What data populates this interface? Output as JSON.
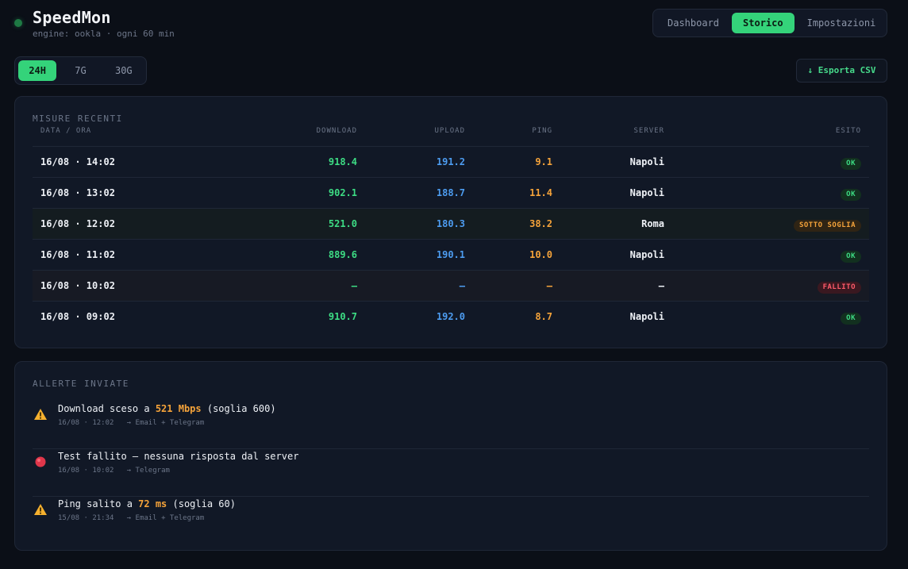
{
  "app": {
    "title": "SpeedMon",
    "subtitle": "engine: ookla · ogni 60 min"
  },
  "nav": {
    "tabs": [
      "Dashboard",
      "Storico",
      "Impostazioni"
    ],
    "active": "Storico"
  },
  "range": {
    "options": [
      "24H",
      "7G",
      "30G"
    ],
    "active": "24H"
  },
  "export": {
    "label": "↓ Esporta CSV"
  },
  "table": {
    "title": "MISURE RECENTI",
    "columns": [
      "DATA / ORA",
      "DOWNLOAD",
      "UPLOAD",
      "PING",
      "SERVER",
      "ESITO"
    ],
    "rows": [
      {
        "date": "16/08 · 14:02",
        "download": "918.4",
        "upload": "191.2",
        "ping": "9.1",
        "server": "Napoli",
        "esito": "OK"
      },
      {
        "date": "16/08 · 13:02",
        "download": "902.1",
        "upload": "188.7",
        "ping": "11.4",
        "server": "Napoli",
        "esito": "OK"
      },
      {
        "date": "16/08 · 12:02",
        "download": "521.0",
        "upload": "180.3",
        "ping": "38.2",
        "server": "Roma",
        "esito": "SOTTO SOGLIA"
      },
      {
        "date": "16/08 · 11:02",
        "download": "889.6",
        "upload": "190.1",
        "ping": "10.0",
        "server": "Napoli",
        "esito": "OK"
      },
      {
        "date": "16/08 · 10:02",
        "download": "—",
        "upload": "—",
        "ping": "—",
        "server": "—",
        "esito": "FALLITO"
      },
      {
        "date": "16/08 · 09:02",
        "download": "910.7",
        "upload": "192.0",
        "ping": "8.7",
        "server": "Napoli",
        "esito": "OK"
      }
    ]
  },
  "alerts": {
    "title": "ALLERTE INVIATE",
    "items": [
      {
        "icon": "warning-icon",
        "pre": "Download sceso a ",
        "value": "521 Mbps",
        "post": " (soglia 600)",
        "time": "16/08 · 12:02",
        "channels": "→ Email + Telegram"
      },
      {
        "icon": "error-dot-icon",
        "text": "Test fallito — nessuna risposta dal server",
        "time": "16/08 · 10:02",
        "channels": "→ Telegram"
      },
      {
        "icon": "warning-icon",
        "pre": "Ping salito a ",
        "value": "72 ms",
        "post": " (soglia 60)",
        "time": "15/08 · 21:34",
        "channels": "→ Email + Telegram"
      }
    ]
  },
  "colors": {
    "accent": "#34d37a",
    "download": "#3ddc84",
    "upload": "#4d9cf0",
    "ping": "#f5a33a",
    "error": "#ff5a6a"
  }
}
